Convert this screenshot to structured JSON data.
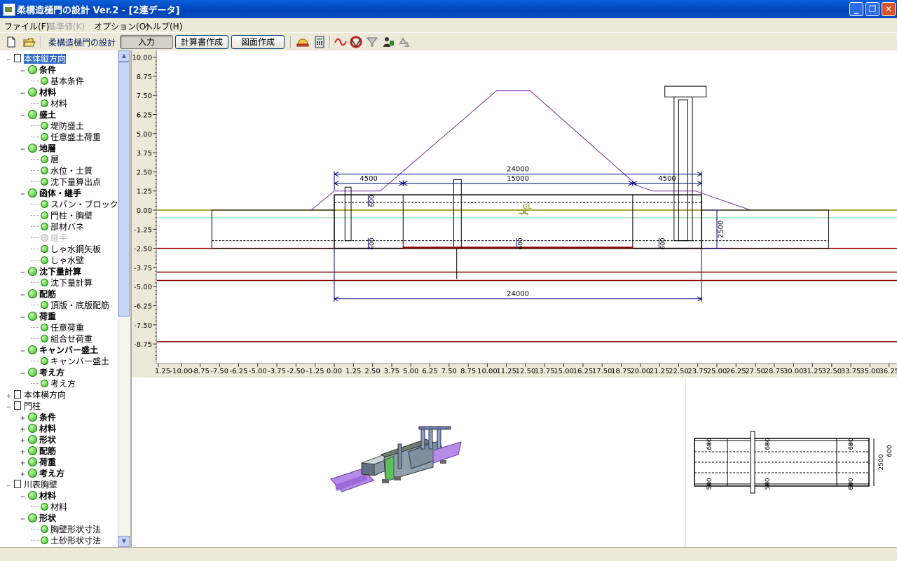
{
  "window": {
    "title": "柔構造樋門の設計 Ver.2 - [2連データ]",
    "min": "_",
    "max": "❐",
    "close": "✕"
  },
  "menu": [
    {
      "label": "ファイル(F)",
      "enabled": true
    },
    {
      "label": "基準値(K)",
      "enabled": false
    },
    {
      "label": "オプション(O)",
      "enabled": true
    },
    {
      "label": "ヘルプ(H)",
      "enabled": true
    }
  ],
  "toolbar": {
    "label": "柔構造樋門の設計",
    "buttons": [
      "入力",
      "計算書作成",
      "図面作成"
    ],
    "icons": [
      "new-file-icon",
      "open-folder-icon",
      "helmet-icon",
      "calculator-icon",
      "wave-icon",
      "lifebuoy-icon",
      "funnel-icon",
      "support-person-icon",
      "recycle-icon"
    ]
  },
  "tree": [
    {
      "label": "本体縦方向",
      "level": 0,
      "icon": "doc-icon",
      "selected": true,
      "expander": "−"
    },
    {
      "label": "条件",
      "level": 1,
      "bold": true
    },
    {
      "label": "基本条件",
      "level": 2
    },
    {
      "label": "材料",
      "level": 1,
      "bold": true
    },
    {
      "label": "材料",
      "level": 2
    },
    {
      "label": "盛土",
      "level": 1,
      "bold": true
    },
    {
      "label": "堤防盛土",
      "level": 2
    },
    {
      "label": "任意盛土荷重",
      "level": 2
    },
    {
      "label": "地層",
      "level": 1,
      "bold": true
    },
    {
      "label": "層",
      "level": 2
    },
    {
      "label": "水位・土質",
      "level": 2
    },
    {
      "label": "沈下量算出点",
      "level": 2
    },
    {
      "label": "函体・継手",
      "level": 1,
      "bold": true
    },
    {
      "label": "スパン・ブロック",
      "level": 2
    },
    {
      "label": "門柱・胸壁",
      "level": 2
    },
    {
      "label": "部材バネ",
      "level": 2
    },
    {
      "label": "継手",
      "level": 2,
      "disabled": true
    },
    {
      "label": "しゃ水鋼矢板",
      "level": 2
    },
    {
      "label": "しゃ水壁",
      "level": 2
    },
    {
      "label": "沈下量計算",
      "level": 1,
      "bold": true
    },
    {
      "label": "沈下量計算",
      "level": 2
    },
    {
      "label": "配筋",
      "level": 1,
      "bold": true
    },
    {
      "label": "頂版・底版配筋",
      "level": 2
    },
    {
      "label": "荷重",
      "level": 1,
      "bold": true
    },
    {
      "label": "任意荷重",
      "level": 2
    },
    {
      "label": "組合せ荷重",
      "level": 2
    },
    {
      "label": "キャンバー盛土",
      "level": 1,
      "bold": true
    },
    {
      "label": "キャンバー盛土",
      "level": 2
    },
    {
      "label": "考え方",
      "level": 1,
      "bold": true
    },
    {
      "label": "考え方",
      "level": 2
    },
    {
      "label": "本体横方向",
      "level": 0,
      "icon": "doc-icon",
      "expander": "+"
    },
    {
      "label": "門柱",
      "level": 0,
      "icon": "doc-icon",
      "expander": "−"
    },
    {
      "label": "条件",
      "level": 1,
      "bold": true,
      "expander": "+"
    },
    {
      "label": "材料",
      "level": 1,
      "bold": true,
      "expander": "+"
    },
    {
      "label": "形状",
      "level": 1,
      "bold": true,
      "expander": "+"
    },
    {
      "label": "配筋",
      "level": 1,
      "bold": true,
      "expander": "+"
    },
    {
      "label": "荷重",
      "level": 1,
      "bold": true,
      "expander": "+"
    },
    {
      "label": "考え方",
      "level": 1,
      "bold": true,
      "expander": "+"
    },
    {
      "label": "川表胸壁",
      "level": 0,
      "icon": "doc-icon",
      "expander": "−"
    },
    {
      "label": "材料",
      "level": 1,
      "bold": true
    },
    {
      "label": "材料",
      "level": 2
    },
    {
      "label": "形状",
      "level": 1,
      "bold": true
    },
    {
      "label": "胸壁形状寸法",
      "level": 2
    },
    {
      "label": "土砂形状寸法",
      "level": 2
    }
  ],
  "drawing": {
    "y_ticks": [
      "10.00",
      "8.75",
      "7.50",
      "6.25",
      "5.00",
      "3.75",
      "2.50",
      "1.25",
      "0.00",
      "-1.25",
      "-2.50",
      "-3.75",
      "-5.00",
      "-6.25",
      "-7.50",
      "-8.75"
    ],
    "x_ticks": [
      "1.25",
      "-10.00",
      "-8.75",
      "-7.50",
      "-6.25",
      "-5.00",
      "-3.75",
      "-2.50",
      "-1.25",
      "0.00",
      "1.25",
      "2.50",
      "3.75",
      "5.00",
      "6.25",
      "7.50",
      "8.75",
      "10.00",
      "11.25",
      "12.50",
      "13.75",
      "15.00",
      "16.25",
      "17.50",
      "18.75",
      "20.00",
      "21.25",
      "22.50",
      "23.75",
      "25.00",
      "26.25",
      "27.50",
      "28.75",
      "30.00",
      "31.25",
      "32.50",
      "33.75",
      "35.00",
      "36.25"
    ],
    "dims": {
      "total_top": "24000",
      "left": "4500",
      "mid": "15000",
      "right": "4500",
      "total_bottom": "24000",
      "height": "2500",
      "t1": "600",
      "t2": "600",
      "t3": "600",
      "t4": "600",
      "t5": "600"
    },
    "gl_label": "GL",
    "colors": {
      "embankment": "#7b2aa8",
      "gl_line": "#8a8a00",
      "water_line": "#7fd6a0",
      "strata": "#8b0000",
      "structure": "#000000",
      "dim": "#000080"
    }
  },
  "section": {
    "dims": {
      "a": "600",
      "b": "500",
      "c": "600",
      "d": "600",
      "e": "500",
      "f": "600",
      "side": "2500",
      "side_t1": "600",
      "side_t2": "500"
    }
  }
}
